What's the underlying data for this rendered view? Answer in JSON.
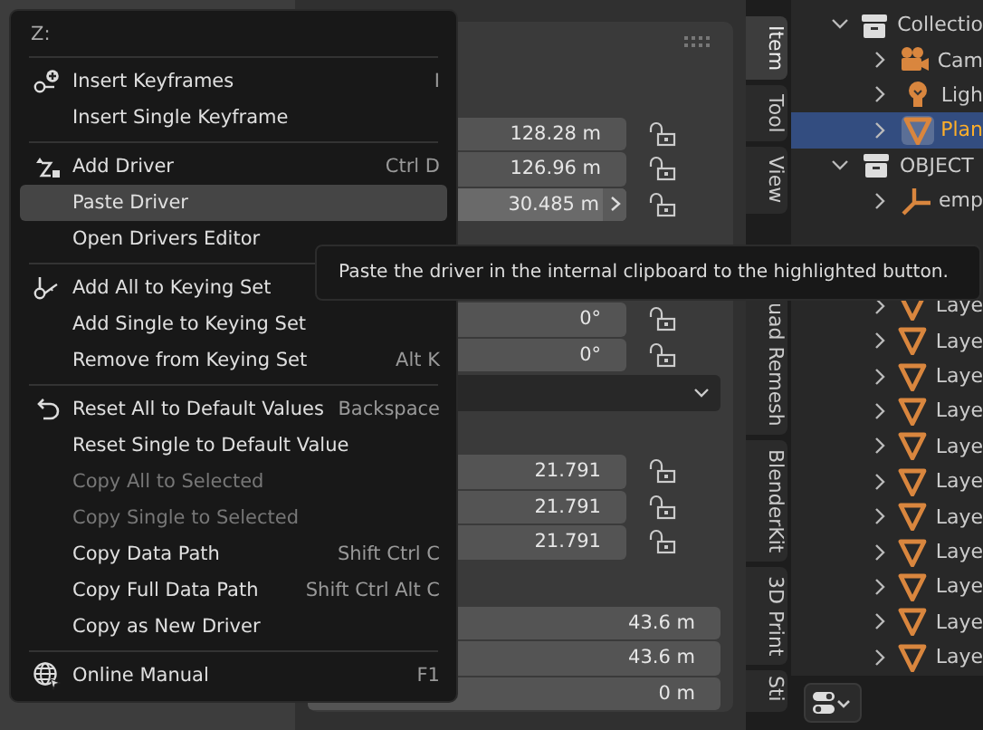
{
  "menu": {
    "title": "Z:",
    "sections": [
      {
        "items": [
          {
            "label": "Insert Keyframes",
            "shortcut": "I",
            "selected": false,
            "disabled": false
          },
          {
            "label": "Insert Single Keyframe",
            "selected": false,
            "disabled": false
          }
        ]
      },
      {
        "items": [
          {
            "label": "Add Driver",
            "shortcut": "Ctrl D",
            "selected": false,
            "disabled": false
          },
          {
            "label": "Paste Driver",
            "selected": true,
            "disabled": false
          },
          {
            "label": "Open Drivers Editor",
            "selected": false,
            "disabled": false
          }
        ]
      },
      {
        "items": [
          {
            "label": "Add All to Keying Set",
            "selected": false,
            "disabled": false
          },
          {
            "label": "Add Single to Keying Set",
            "selected": false,
            "disabled": false
          },
          {
            "label": "Remove from Keying Set",
            "shortcut": "Alt K",
            "selected": false,
            "disabled": false
          }
        ]
      },
      {
        "items": [
          {
            "label": "Reset All to Default Values",
            "shortcut": "Backspace",
            "selected": false,
            "disabled": false
          },
          {
            "label": "Reset Single to Default Value",
            "selected": false,
            "disabled": false
          },
          {
            "label": "Copy All to Selected",
            "selected": false,
            "disabled": true
          },
          {
            "label": "Copy Single to Selected",
            "selected": false,
            "disabled": true
          },
          {
            "label": "Copy Data Path",
            "shortcut": "Shift Ctrl C",
            "selected": false,
            "disabled": false
          },
          {
            "label": "Copy Full Data Path",
            "shortcut": "Shift Ctrl Alt C",
            "selected": false,
            "disabled": false
          },
          {
            "label": "Copy as New Driver",
            "selected": false,
            "disabled": false
          }
        ]
      },
      {
        "items": [
          {
            "label": "Online Manual",
            "shortcut": "F1",
            "selected": false,
            "disabled": false
          }
        ]
      }
    ]
  },
  "tooltip": {
    "text": "Paste the driver in the internal clipboard to the highlighted button."
  },
  "properties": {
    "rows": [
      {
        "kind": "field",
        "value": "128.28 m",
        "highlighted": false,
        "locked": false
      },
      {
        "kind": "field",
        "value": "126.96 m",
        "highlighted": false,
        "locked": false
      },
      {
        "kind": "field",
        "value": "30.485 m",
        "highlighted": true,
        "locked": false
      },
      {
        "kind": "gap"
      },
      {
        "kind": "field",
        "value": "0°",
        "highlighted": false,
        "locked": false
      },
      {
        "kind": "field",
        "value": "0°",
        "highlighted": false,
        "locked": false
      },
      {
        "kind": "dropdown"
      },
      {
        "kind": "gap"
      },
      {
        "kind": "field",
        "value": "21.791",
        "highlighted": false,
        "locked": false
      },
      {
        "kind": "field",
        "value": "21.791",
        "highlighted": false,
        "locked": false
      },
      {
        "kind": "field",
        "value": "21.791",
        "highlighted": false,
        "locked": false
      },
      {
        "kind": "gap"
      },
      {
        "kind": "wide",
        "value": "43.6 m"
      },
      {
        "kind": "wide",
        "value": "43.6 m"
      },
      {
        "kind": "wide",
        "value": "0 m"
      }
    ]
  },
  "tabs": [
    {
      "label": "Item",
      "selected": true
    },
    {
      "label": "Tool",
      "selected": false
    },
    {
      "label": "View",
      "selected": false
    },
    {
      "label": "uad Remesh",
      "selected": false
    },
    {
      "label": "BlenderKit",
      "selected": false
    },
    {
      "label": "3D Print",
      "selected": false
    },
    {
      "label": "Sti",
      "selected": false
    }
  ],
  "outliner": {
    "items": [
      {
        "label": "Collectio",
        "kind": "collection",
        "expanded": true,
        "selected": false,
        "children": [
          {
            "label": "Cam",
            "kind": "camera",
            "expanded": false,
            "selected": false
          },
          {
            "label": "Ligh",
            "kind": "light",
            "expanded": false,
            "selected": false
          },
          {
            "label": "Plan",
            "kind": "mesh",
            "expanded": false,
            "selected": true
          }
        ]
      },
      {
        "label": "OBJECT",
        "kind": "collection",
        "expanded": true,
        "selected": false,
        "children": [
          {
            "label": "emp",
            "kind": "empty",
            "expanded": false,
            "selected": false
          },
          {
            "kind": "covered"
          },
          {
            "kind": "covered"
          },
          {
            "label": "Laye",
            "kind": "mesh",
            "expanded": false,
            "selected": false
          },
          {
            "label": "Laye",
            "kind": "mesh",
            "expanded": false,
            "selected": false
          },
          {
            "label": "Laye",
            "kind": "mesh",
            "expanded": false,
            "selected": false
          },
          {
            "label": "Laye",
            "kind": "mesh",
            "expanded": false,
            "selected": false
          },
          {
            "label": "Laye",
            "kind": "mesh",
            "expanded": false,
            "selected": false
          },
          {
            "label": "Laye",
            "kind": "mesh",
            "expanded": false,
            "selected": false
          },
          {
            "label": "Laye",
            "kind": "mesh",
            "expanded": false,
            "selected": false
          },
          {
            "label": "Laye",
            "kind": "mesh",
            "expanded": false,
            "selected": false
          },
          {
            "label": "Laye",
            "kind": "mesh",
            "expanded": false,
            "selected": false
          },
          {
            "label": "Laye",
            "kind": "mesh",
            "expanded": false,
            "selected": false
          },
          {
            "label": "Laye",
            "kind": "mesh",
            "expanded": false,
            "selected": false
          }
        ]
      }
    ]
  }
}
